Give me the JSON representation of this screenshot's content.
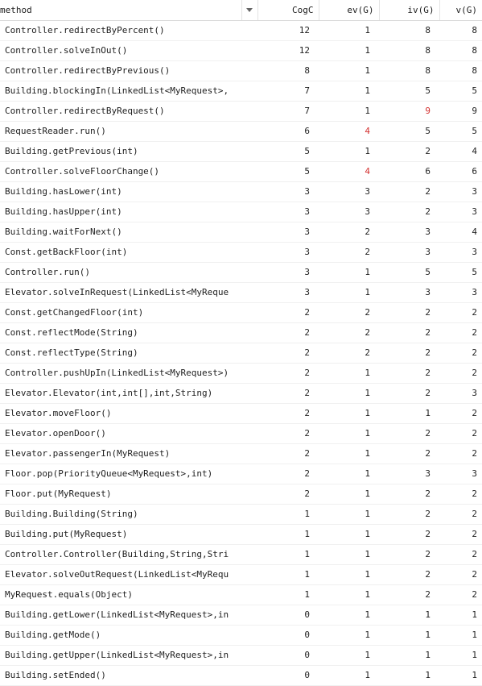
{
  "headers": {
    "method": "method",
    "cogc": "CogC",
    "ev": "ev(G)",
    "iv": "iv(G)",
    "v": "v(G)"
  },
  "sort_icon": "triangle-down-icon",
  "warning_color": "#d3302f",
  "rows": [
    {
      "method": "Controller.redirectByPercent()",
      "cogc": "12",
      "ev": "1",
      "iv": "8",
      "v": "8",
      "warn": []
    },
    {
      "method": "Controller.solveInOut()",
      "cogc": "12",
      "ev": "1",
      "iv": "8",
      "v": "8",
      "warn": []
    },
    {
      "method": "Controller.redirectByPrevious()",
      "cogc": "8",
      "ev": "1",
      "iv": "8",
      "v": "8",
      "warn": []
    },
    {
      "method": "Building.blockingIn(LinkedList<MyRequest>,",
      "cogc": "7",
      "ev": "1",
      "iv": "5",
      "v": "5",
      "warn": []
    },
    {
      "method": "Controller.redirectByRequest()",
      "cogc": "7",
      "ev": "1",
      "iv": "9",
      "v": "9",
      "warn": [
        "iv"
      ]
    },
    {
      "method": "RequestReader.run()",
      "cogc": "6",
      "ev": "4",
      "iv": "5",
      "v": "5",
      "warn": [
        "ev"
      ]
    },
    {
      "method": "Building.getPrevious(int)",
      "cogc": "5",
      "ev": "1",
      "iv": "2",
      "v": "4",
      "warn": []
    },
    {
      "method": "Controller.solveFloorChange()",
      "cogc": "5",
      "ev": "4",
      "iv": "6",
      "v": "6",
      "warn": [
        "ev"
      ]
    },
    {
      "method": "Building.hasLower(int)",
      "cogc": "3",
      "ev": "3",
      "iv": "2",
      "v": "3",
      "warn": []
    },
    {
      "method": "Building.hasUpper(int)",
      "cogc": "3",
      "ev": "3",
      "iv": "2",
      "v": "3",
      "warn": []
    },
    {
      "method": "Building.waitForNext()",
      "cogc": "3",
      "ev": "2",
      "iv": "3",
      "v": "4",
      "warn": []
    },
    {
      "method": "Const.getBackFloor(int)",
      "cogc": "3",
      "ev": "2",
      "iv": "3",
      "v": "3",
      "warn": []
    },
    {
      "method": "Controller.run()",
      "cogc": "3",
      "ev": "1",
      "iv": "5",
      "v": "5",
      "warn": []
    },
    {
      "method": "Elevator.solveInRequest(LinkedList<MyReque",
      "cogc": "3",
      "ev": "1",
      "iv": "3",
      "v": "3",
      "warn": []
    },
    {
      "method": "Const.getChangedFloor(int)",
      "cogc": "2",
      "ev": "2",
      "iv": "2",
      "v": "2",
      "warn": []
    },
    {
      "method": "Const.reflectMode(String)",
      "cogc": "2",
      "ev": "2",
      "iv": "2",
      "v": "2",
      "warn": []
    },
    {
      "method": "Const.reflectType(String)",
      "cogc": "2",
      "ev": "2",
      "iv": "2",
      "v": "2",
      "warn": []
    },
    {
      "method": "Controller.pushUpIn(LinkedList<MyRequest>)",
      "cogc": "2",
      "ev": "1",
      "iv": "2",
      "v": "2",
      "warn": []
    },
    {
      "method": "Elevator.Elevator(int,int[],int,String)",
      "cogc": "2",
      "ev": "1",
      "iv": "2",
      "v": "3",
      "warn": []
    },
    {
      "method": "Elevator.moveFloor()",
      "cogc": "2",
      "ev": "1",
      "iv": "1",
      "v": "2",
      "warn": []
    },
    {
      "method": "Elevator.openDoor()",
      "cogc": "2",
      "ev": "1",
      "iv": "2",
      "v": "2",
      "warn": []
    },
    {
      "method": "Elevator.passengerIn(MyRequest)",
      "cogc": "2",
      "ev": "1",
      "iv": "2",
      "v": "2",
      "warn": []
    },
    {
      "method": "Floor.pop(PriorityQueue<MyRequest>,int)",
      "cogc": "2",
      "ev": "1",
      "iv": "3",
      "v": "3",
      "warn": []
    },
    {
      "method": "Floor.put(MyRequest)",
      "cogc": "2",
      "ev": "1",
      "iv": "2",
      "v": "2",
      "warn": []
    },
    {
      "method": "Building.Building(String)",
      "cogc": "1",
      "ev": "1",
      "iv": "2",
      "v": "2",
      "warn": []
    },
    {
      "method": "Building.put(MyRequest)",
      "cogc": "1",
      "ev": "1",
      "iv": "2",
      "v": "2",
      "warn": []
    },
    {
      "method": "Controller.Controller(Building,String,Stri",
      "cogc": "1",
      "ev": "1",
      "iv": "2",
      "v": "2",
      "warn": []
    },
    {
      "method": "Elevator.solveOutRequest(LinkedList<MyRequ",
      "cogc": "1",
      "ev": "1",
      "iv": "2",
      "v": "2",
      "warn": []
    },
    {
      "method": "MyRequest.equals(Object)",
      "cogc": "1",
      "ev": "1",
      "iv": "2",
      "v": "2",
      "warn": []
    },
    {
      "method": "Building.getLower(LinkedList<MyRequest>,in",
      "cogc": "0",
      "ev": "1",
      "iv": "1",
      "v": "1",
      "warn": []
    },
    {
      "method": "Building.getMode()",
      "cogc": "0",
      "ev": "1",
      "iv": "1",
      "v": "1",
      "warn": []
    },
    {
      "method": "Building.getUpper(LinkedList<MyRequest>,in",
      "cogc": "0",
      "ev": "1",
      "iv": "1",
      "v": "1",
      "warn": []
    },
    {
      "method": "Building.setEnded()",
      "cogc": "0",
      "ev": "1",
      "iv": "1",
      "v": "1",
      "warn": []
    }
  ]
}
